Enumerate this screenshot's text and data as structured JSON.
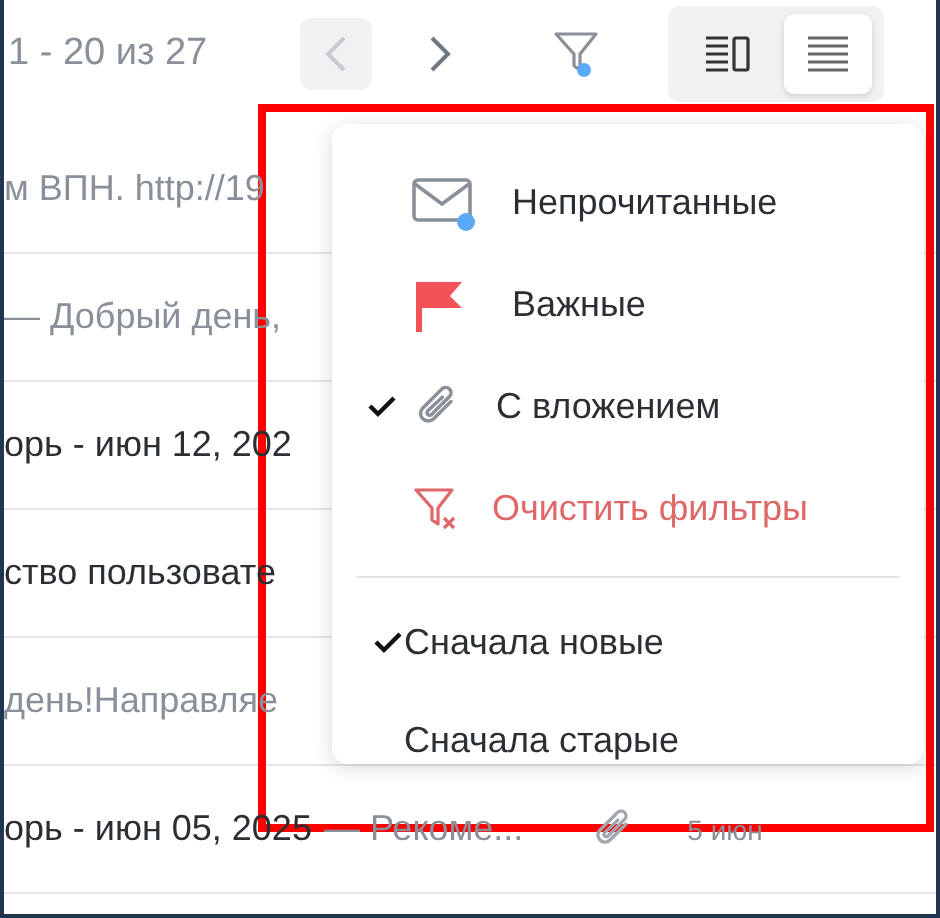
{
  "pager": {
    "range": "1 - 20 из 27",
    "prev_disabled": true,
    "next_disabled": false
  },
  "filter_button": {
    "active": true
  },
  "view_modes": [
    {
      "kind": "split",
      "selected": false
    },
    {
      "kind": "list",
      "selected": true
    }
  ],
  "rows": [
    {
      "text": "м ВПН. http://19",
      "read": true
    },
    {
      "text": "— Добрый день,",
      "read": true
    },
    {
      "text": "орь - июн 12, 202",
      "read": false
    },
    {
      "text": "ство пользовате",
      "read": false
    },
    {
      "text": "день!Направляе",
      "read": true
    },
    {
      "text": "орь - июн 05, 2025",
      "preview": "— Рекоме...",
      "read": false,
      "attachment": true,
      "date": "5 июн"
    }
  ],
  "menu": {
    "filters": [
      {
        "kind": "unread",
        "label": "Непрочитанные",
        "checked": false
      },
      {
        "kind": "important",
        "label": "Важные",
        "checked": false
      },
      {
        "kind": "attachment",
        "label": "С вложением",
        "checked": true
      },
      {
        "kind": "clear",
        "label": "Очистить фильтры"
      }
    ],
    "sort": [
      {
        "label": "Сначала новые",
        "checked": true
      },
      {
        "label": "Сначала старые",
        "checked": false
      }
    ]
  }
}
